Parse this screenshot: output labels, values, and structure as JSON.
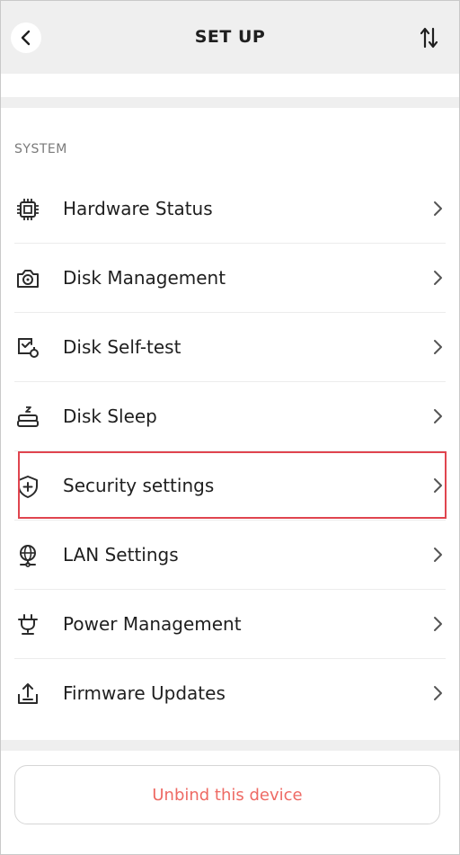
{
  "header": {
    "title": "SET UP",
    "back_icon": "chevron-left-icon",
    "sort_icon": "sort-arrows-icon"
  },
  "section": {
    "label": "SYSTEM"
  },
  "items": [
    {
      "label": "Hardware Status",
      "icon": "cpu-chip-icon"
    },
    {
      "label": "Disk Management",
      "icon": "disk-camera-icon"
    },
    {
      "label": "Disk Self-test",
      "icon": "disk-check-icon"
    },
    {
      "label": "Disk Sleep",
      "icon": "disk-sleep-icon"
    },
    {
      "label": "Security settings",
      "icon": "shield-plus-icon"
    },
    {
      "label": "LAN Settings",
      "icon": "globe-network-icon"
    },
    {
      "label": "Power Management",
      "icon": "power-plug-icon"
    },
    {
      "label": "Firmware Updates",
      "icon": "upload-tray-icon"
    }
  ],
  "unbind_label": "Unbind this device",
  "colors": {
    "accent_red": "#ee6a64",
    "highlight_red": "#e0454f",
    "header_gray": "#efefef"
  }
}
